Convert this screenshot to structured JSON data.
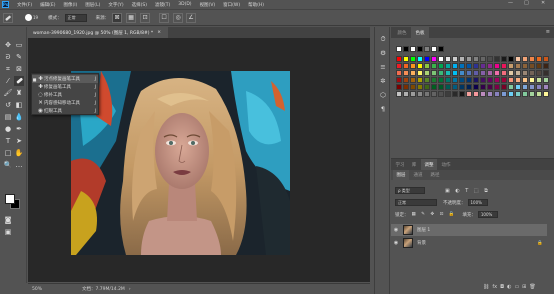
{
  "app": {
    "logo_text": "Ps",
    "menu": [
      "文件(F)",
      "编辑(E)",
      "图像(I)",
      "图层(L)",
      "文字(Y)",
      "选择(S)",
      "滤镜(T)",
      "3D(D)",
      "视图(V)",
      "窗口(W)",
      "帮助(H)"
    ],
    "window_controls": {
      "minimize": "—",
      "maximize": "□",
      "close": "✕"
    }
  },
  "options": {
    "brush_size": "19",
    "mode_label": "模式：",
    "mode_value": "正常",
    "source_label": "来源：",
    "icons": [
      "sample-all-layers-icon",
      "diffusion-icon",
      "pressure-icon"
    ]
  },
  "document": {
    "tab_title": "woman-3990680_1920.jpg @ 50% (图层 1, RGB/8#) *",
    "tab_close": "×",
    "zoom": "50%",
    "doc_size": "文档：7.79M/14.2M",
    "status_arrow": "›"
  },
  "flyout": {
    "items": [
      {
        "label": "污点修复画笔工具",
        "key": "J",
        "icon": "spot-healing-icon",
        "active": true
      },
      {
        "label": "修复画笔工具",
        "key": "J",
        "icon": "healing-brush-icon",
        "active": false
      },
      {
        "label": "修补工具",
        "key": "J",
        "icon": "patch-icon",
        "active": false
      },
      {
        "label": "内容感知移动工具",
        "key": "J",
        "icon": "content-aware-move-icon",
        "active": false
      },
      {
        "label": "红眼工具",
        "key": "J",
        "icon": "red-eye-icon",
        "active": false
      }
    ]
  },
  "swatches": {
    "tabs": [
      "颜色",
      "色板"
    ],
    "active_tab": "色板",
    "basic_row": [
      "#ffffff",
      "#000000",
      "#ffffff",
      "#000000",
      "#808080",
      "#ffffff",
      "#000000"
    ],
    "rows": [
      [
        "#ff0000",
        "#ffff00",
        "#00ff00",
        "#00ffff",
        "#0000ff",
        "#ff00ff",
        "#ffffff",
        "#e6e6e6",
        "#cccccc",
        "#b3b3b3",
        "#999999",
        "#808080",
        "#666666",
        "#4d4d4d",
        "#333333",
        "#1a1a1a",
        "#000000",
        "#f7c6a6",
        "#f2a477",
        "#ee8448",
        "#ea6a1d",
        "#c9561a"
      ],
      [
        "#ed1c24",
        "#f26522",
        "#f7941d",
        "#fff200",
        "#8dc63f",
        "#39b54a",
        "#00a651",
        "#00a99d",
        "#00aeef",
        "#0072bc",
        "#0054a6",
        "#2e3192",
        "#662d91",
        "#92278f",
        "#ec008c",
        "#ed145b",
        "#c69c6d",
        "#a67c52",
        "#8c6239",
        "#754c24",
        "#603913",
        "#3c2415"
      ],
      [
        "#f26c4f",
        "#f68e56",
        "#fbaf5d",
        "#fff568",
        "#acd373",
        "#7cc576",
        "#3bb878",
        "#1abbb4",
        "#00bff3",
        "#438ccb",
        "#5674b9",
        "#605ca8",
        "#855fa8",
        "#a763a8",
        "#f06eaa",
        "#f26d7d",
        "#e1c9a5",
        "#c7b299",
        "#998675",
        "#736357",
        "#534741",
        "#362f2d"
      ],
      [
        "#9e0b0f",
        "#a0410d",
        "#a36209",
        "#aba000",
        "#598527",
        "#1a7b30",
        "#007236",
        "#00746b",
        "#0076a3",
        "#004a80",
        "#003471",
        "#1b1464",
        "#440e62",
        "#630460",
        "#9e005d",
        "#9e0039",
        "#f69679",
        "#f9ad81",
        "#fdc68a",
        "#fff799",
        "#c4df9b",
        "#a3d39c"
      ],
      [
        "#790000",
        "#7b2e00",
        "#7d4900",
        "#827b00",
        "#406618",
        "#005e20",
        "#005826",
        "#005952",
        "#005b7f",
        "#003663",
        "#002157",
        "#0d004c",
        "#32004b",
        "#4b0049",
        "#7b0046",
        "#7a0026",
        "#82ca9c",
        "#6dcff6",
        "#7da7d9",
        "#8393ca",
        "#8781bd",
        "#a186be"
      ],
      [
        "#c4c4c4",
        "#b0b0b0",
        "#9c9c9c",
        "#898989",
        "#767676",
        "#636363",
        "#505050",
        "#3d3d3d",
        "#2a2a2a",
        "#171717",
        "#f4a09c",
        "#f5989d",
        "#bd8cbf",
        "#a187be",
        "#8882be",
        "#7c9bd4",
        "#6dcff6",
        "#7accc8",
        "#82ca9d",
        "#a4d49d",
        "#c4df9b",
        "#fff79a"
      ]
    ]
  },
  "layers": {
    "tabs": [
      "学习",
      "库",
      "调整",
      "图层",
      "通道",
      "路径",
      "动作"
    ],
    "top_tabs": [
      "学习",
      "库",
      "调整",
      "动作"
    ],
    "sub_tabs": [
      "图层",
      "通道",
      "路径"
    ],
    "active_tab": "图层",
    "filter_kind": "ρ 类型",
    "blend_mode": "正常",
    "opacity_label": "不透明度：",
    "opacity_value": "100%",
    "lock_label": "锁定：",
    "fill_label": "填充：",
    "fill_value": "100%",
    "items": [
      {
        "name": "图层 1",
        "selected": true,
        "visible": true
      },
      {
        "name": "背景",
        "selected": false,
        "visible": true,
        "locked": true
      }
    ],
    "lock_glyph": "🔒",
    "bottom_icons": [
      "link-icon",
      "fx-icon",
      "mask-icon",
      "adjustment-icon",
      "group-icon",
      "new-layer-icon",
      "trash-icon"
    ]
  }
}
